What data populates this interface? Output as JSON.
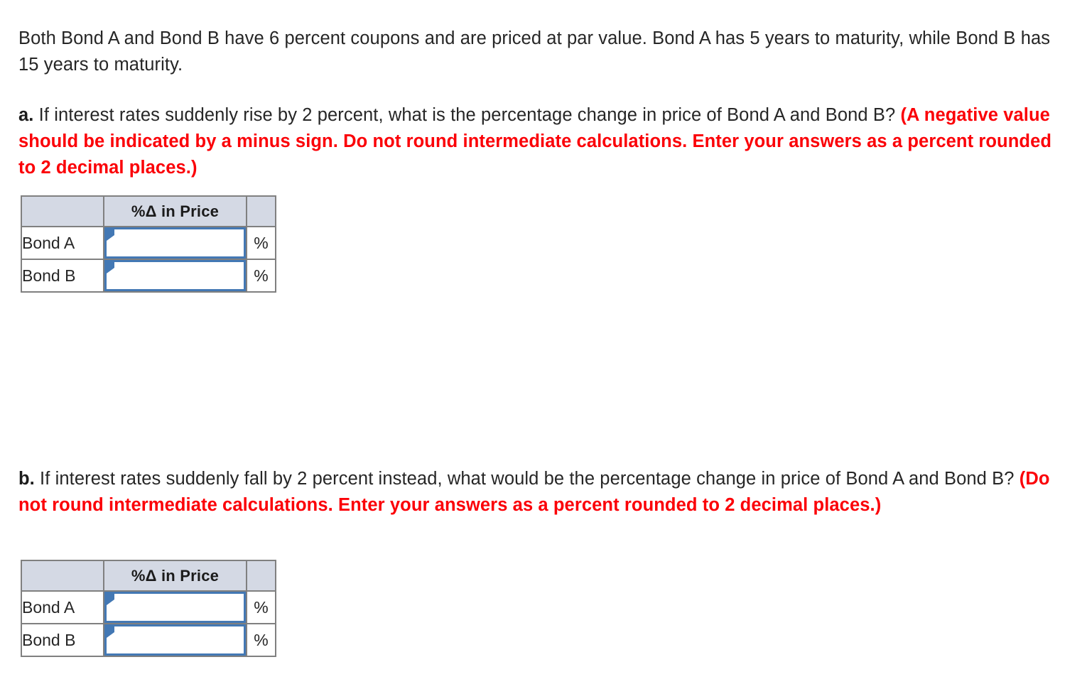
{
  "document": {
    "intro": {
      "text": "Both Bond A and Bond B have 6 percent coupons and are priced at par value. Bond A has 5 years to maturity, while Bond B has 15 years to maturity."
    },
    "part_a": {
      "marker": "a.",
      "question": " If interest rates suddenly rise by 2 percent, what is the percentage change in price of Bond A and Bond B? ",
      "instruction": "(A negative value should be indicated by a minus sign. Do not round intermediate calculations. Enter your answers as a percent rounded to 2 decimal places.)"
    },
    "part_b": {
      "marker": "b.",
      "question": " If interest rates suddenly fall by 2 percent instead, what would be the percentage change in price of Bond A and Bond B? ",
      "instruction": "(Do not round intermediate calculations. Enter your answers as a percent rounded to 2 decimal places.)"
    }
  },
  "table_a": {
    "headers": [
      "",
      "%Δ in Price",
      ""
    ],
    "rows": [
      {
        "label": "Bond A",
        "value": "",
        "placeholder": "",
        "unit": "%"
      },
      {
        "label": "Bond B",
        "value": "",
        "placeholder": "",
        "unit": "%"
      }
    ]
  },
  "table_b": {
    "headers": [
      "",
      "%Δ in Price",
      ""
    ],
    "rows": [
      {
        "label": "Bond A",
        "value": "",
        "placeholder": "",
        "unit": "%"
      },
      {
        "label": "Bond B",
        "value": "",
        "placeholder": "",
        "unit": "%"
      }
    ]
  },
  "colors": {
    "instruction_red": "#fb0007",
    "header_fill": "#d4d9e4",
    "input_border_blue": "#4378b4",
    "cell_border_gray": "#808080",
    "body_text": "#262626"
  }
}
